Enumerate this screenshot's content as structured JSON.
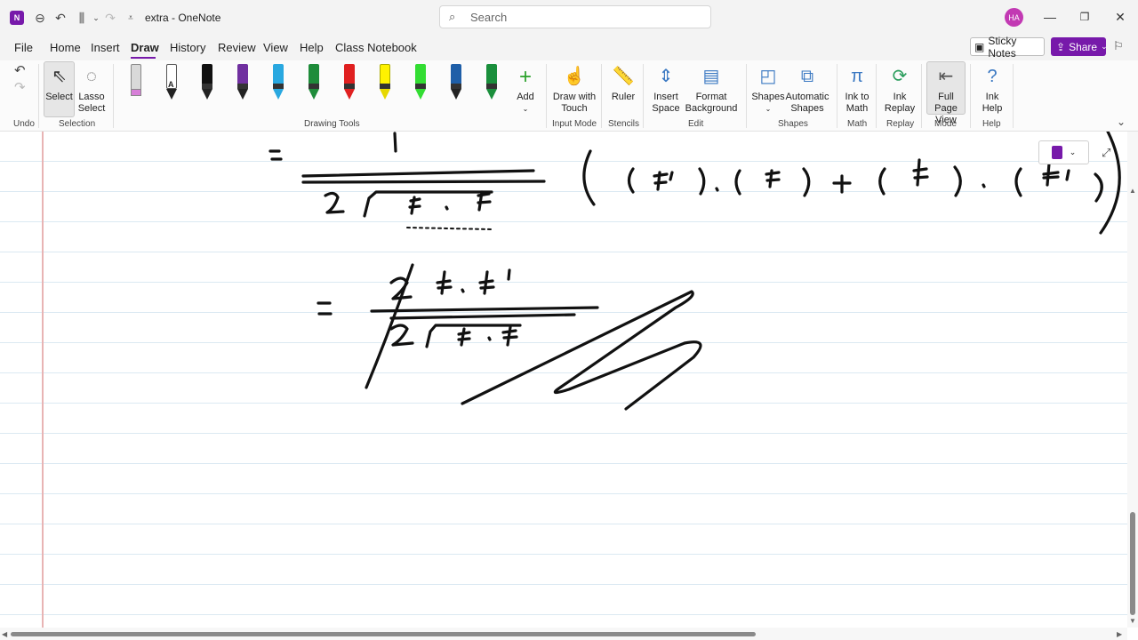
{
  "app": {
    "window_title": "extra - OneNote",
    "search_placeholder": "Search",
    "avatar_initials": "HA",
    "accent_color": "#7719aa"
  },
  "menu": {
    "items": [
      "File",
      "Home",
      "Insert",
      "Draw",
      "History",
      "Review",
      "View",
      "Help",
      "Class Notebook"
    ],
    "active": "Draw",
    "sticky_notes": "Sticky Notes",
    "share": "Share"
  },
  "ribbon": {
    "select": "Select",
    "lasso_line1": "Lasso",
    "lasso_line2": "Select",
    "add": "Add",
    "draw_touch_line1": "Draw with",
    "draw_touch_line2": "Touch",
    "ruler": "Ruler",
    "insert_space_line1": "Insert",
    "insert_space_line2": "Space",
    "format_bg_line1": "Format",
    "format_bg_line2": "Background",
    "shapes": "Shapes",
    "auto_shapes_line1": "Automatic",
    "auto_shapes_line2": "Shapes",
    "ink_math_line1": "Ink to",
    "ink_math_line2": "Math",
    "ink_replay_line1": "Ink",
    "ink_replay_line2": "Replay",
    "full_page_line1": "Full Page",
    "full_page_line2": "View",
    "ink_help_line1": "Ink",
    "ink_help_line2": "Help",
    "groups": {
      "undo": "Undo",
      "selection": "Selection",
      "drawing_tools": "Drawing Tools",
      "input_mode": "Input Mode",
      "stencils": "Stencils",
      "edit": "Edit",
      "shapes": "Shapes",
      "math": "Math",
      "replay": "Replay",
      "mode": "Mode",
      "help": "Help"
    },
    "pens": [
      {
        "name": "eraser",
        "color": "#d9d9d9"
      },
      {
        "name": "pencil",
        "color": "#ffffff"
      },
      {
        "name": "pen-black",
        "color": "#111111"
      },
      {
        "name": "pen-purple",
        "color": "#7030a0"
      },
      {
        "name": "pen-cyan",
        "color": "#29a8e0"
      },
      {
        "name": "pen-green",
        "color": "#1e8c3a"
      },
      {
        "name": "pen-red",
        "color": "#e02020"
      },
      {
        "name": "highlighter-yellow",
        "color": "#fff200"
      },
      {
        "name": "highlighter-green",
        "color": "#33dd33"
      },
      {
        "name": "pen-blue",
        "color": "#1f5fa8"
      },
      {
        "name": "pen-darkgreen",
        "color": "#1a8f3c"
      }
    ]
  }
}
